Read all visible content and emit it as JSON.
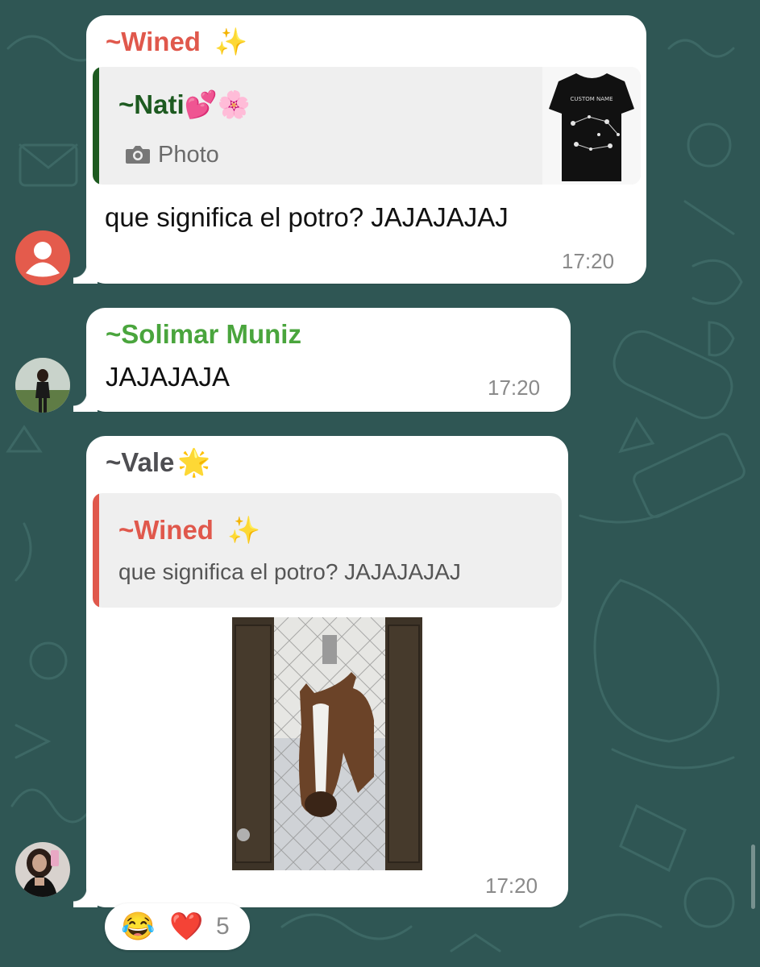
{
  "colors": {
    "background": "#2f5654",
    "wined": "#e0584c",
    "nati": "#1d5a20",
    "solimar": "#4aa53d",
    "vale": "#4e4e52",
    "time": "#8a8a8a"
  },
  "messages": [
    {
      "sender": "~Wined",
      "sender_emoji": "✨",
      "quote": {
        "sender": "~Nati",
        "sender_emoji": "💕🌸",
        "camera_icon": "camera-icon",
        "label": "Photo",
        "thumbnail_text": "CUSTOM NAME"
      },
      "text": "que significa el potro? JAJAJAJAJ",
      "time": "17:20",
      "avatar": "default-person-icon"
    },
    {
      "sender": "~Solimar Muniz",
      "text": "JAJAJAJA",
      "time": "17:20",
      "avatar": "photo"
    },
    {
      "sender": "~Vale",
      "sender_emoji": "🌟",
      "quote": {
        "sender": "~Wined",
        "sender_emoji": "✨",
        "text": "que significa el potro? JAJAJAJAJ"
      },
      "image": "horse-at-door",
      "time": "17:20",
      "avatar": "photo",
      "reactions": {
        "emojis": [
          "😂",
          "❤️"
        ],
        "count": "5"
      }
    }
  ]
}
